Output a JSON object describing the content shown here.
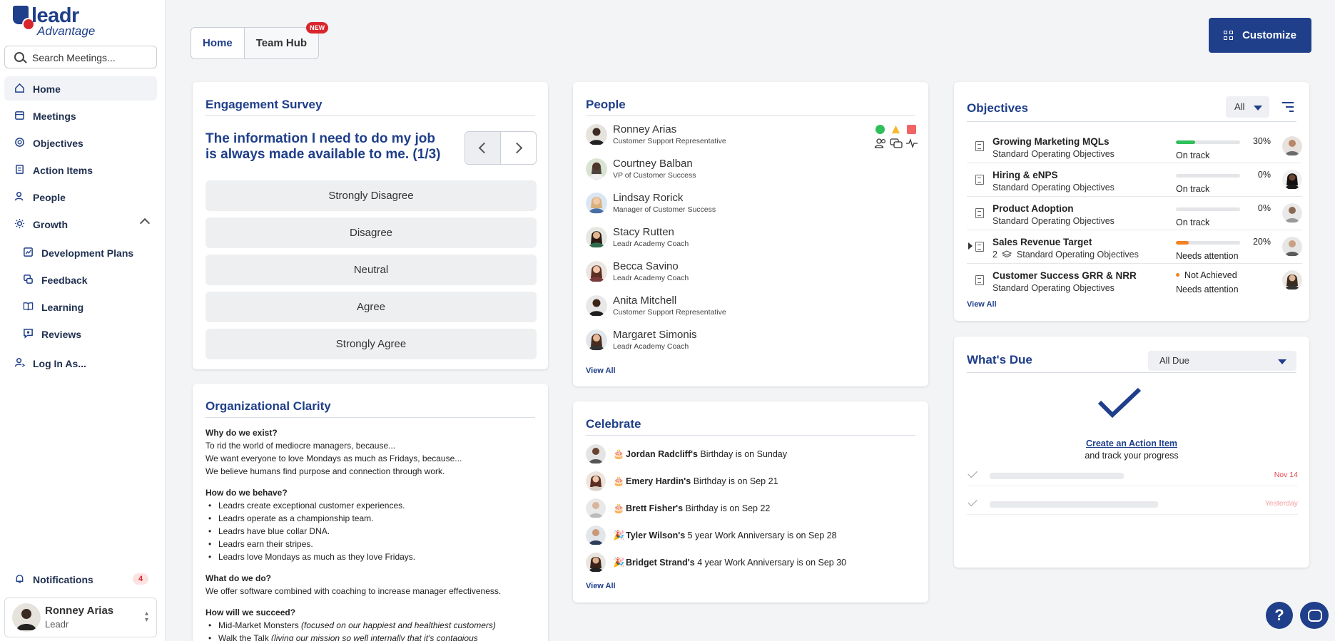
{
  "brand": {
    "name": "leadr",
    "sub": "Advantage"
  },
  "search": {
    "placeholder": "Search Meetings..."
  },
  "sidebar": {
    "items": [
      {
        "label": "Home",
        "icon": "home-icon",
        "active": true
      },
      {
        "label": "Meetings",
        "icon": "calendar-icon"
      },
      {
        "label": "Objectives",
        "icon": "target-icon"
      },
      {
        "label": "Action Items",
        "icon": "checklist-icon"
      },
      {
        "label": "People",
        "icon": "people-icon"
      },
      {
        "label": "Growth",
        "icon": "sun-icon"
      }
    ],
    "growth_items": [
      {
        "label": "Development Plans",
        "icon": "chart-icon"
      },
      {
        "label": "Feedback",
        "icon": "feedback-icon"
      },
      {
        "label": "Learning",
        "icon": "book-icon"
      },
      {
        "label": "Reviews",
        "icon": "review-icon"
      }
    ],
    "login_as": "Log In As...",
    "notifications": {
      "label": "Notifications",
      "count": "4"
    },
    "user": {
      "name": "Ronney Arias",
      "role": "Leadr"
    }
  },
  "tabs": [
    {
      "label": "Home",
      "active": true
    },
    {
      "label": "Team Hub",
      "badge": "NEW"
    }
  ],
  "customize_label": "Customize",
  "engagement": {
    "title": "Engagement Survey",
    "question": "The information I need to do my job is always made available to me.  (1/3)",
    "options": [
      "Strongly Disagree",
      "Disagree",
      "Neutral",
      "Agree",
      "Strongly Agree"
    ]
  },
  "org": {
    "title": "Organizational Clarity",
    "sections": [
      {
        "heading": "Why do we exist?",
        "lines": [
          "To rid the world of mediocre managers, because...",
          "We want everyone to love Mondays as much as Fridays, because...",
          "We believe humans find purpose and connection through work."
        ]
      },
      {
        "heading": "How do we behave?",
        "bullets": [
          "Leadrs create exceptional customer experiences.",
          "Leadrs operate as a championship team.",
          "Leadrs have blue collar DNA.",
          "Leadrs earn their stripes.",
          "Leadrs love Mondays as much as they love Fridays."
        ]
      },
      {
        "heading": "What do we do?",
        "lines": [
          "We offer software combined with coaching to increase manager effectiveness."
        ]
      },
      {
        "heading": "How will we succeed?",
        "bullets_rich": [
          {
            "main": "Mid-Market Monsters ",
            "em": "(focused on our happiest and healthiest customers)"
          },
          {
            "main": "Walk the Talk ",
            "em": "(living our mission so well internally that it's contagious"
          }
        ]
      }
    ]
  },
  "people": {
    "title": "People",
    "list": [
      {
        "name": "Ronney Arias",
        "title": "Customer Support Representative"
      },
      {
        "name": "Courtney Balban",
        "title": "VP of Customer Success"
      },
      {
        "name": "Lindsay Rorick",
        "title": "Manager of Customer Success"
      },
      {
        "name": "Stacy Rutten",
        "title": "Leadr Academy Coach"
      },
      {
        "name": "Becca Savino",
        "title": "Leadr Academy Coach"
      },
      {
        "name": "Anita Mitchell",
        "title": "Customer Support Representative"
      },
      {
        "name": "Margaret Simonis",
        "title": "Leadr Academy Coach"
      }
    ],
    "view_all": "View All",
    "colors": {
      "green": "#2fbf5b",
      "amber": "#f5b82e",
      "red": "#f26464"
    }
  },
  "celebrate": {
    "title": "Celebrate",
    "list": [
      {
        "emoji": "🎂",
        "name": "Jordan Radcliff's",
        "text": " Birthday is on Sunday"
      },
      {
        "emoji": "🎂",
        "name": "Emery Hardin's",
        "text": " Birthday is on Sep 21"
      },
      {
        "emoji": "🎂",
        "name": "Brett Fisher's",
        "text": " Birthday is on Sep 22"
      },
      {
        "emoji": "🎉",
        "name": "Tyler Wilson's",
        "text": " 5 year Work Anniversary is on Sep 28"
      },
      {
        "emoji": "🎉",
        "name": "Bridget Strand's",
        "text": " 4 year Work Anniversary is on Sep 30"
      }
    ],
    "view_all": "View All"
  },
  "objectives": {
    "title": "Objectives",
    "filter": "All",
    "list": [
      {
        "name": "Growing Marketing MQLs",
        "sub": "Standard Operating Objectives",
        "progress": 30,
        "pct": "30%",
        "status": "On track",
        "color": "#2fbf5b"
      },
      {
        "name": "Hiring & eNPS",
        "sub": "Standard Operating Objectives",
        "progress": 0,
        "pct": "0%",
        "status": "On track",
        "color": "#2fbf5b"
      },
      {
        "name": "Product Adoption",
        "sub": "Standard Operating Objectives",
        "progress": 0,
        "pct": "0%",
        "status": "On track",
        "color": "#2fbf5b"
      },
      {
        "name": "Sales Revenue Target",
        "sub_count": "2",
        "sub": "Standard Operating Objectives",
        "progress": 20,
        "pct": "20%",
        "status": "Needs attention",
        "color": "#f5821f",
        "expandable": true
      },
      {
        "name": "Customer Success GRR & NRR",
        "sub": "Standard Operating Objectives",
        "badge": "Not Achieved",
        "status": "Needs attention"
      }
    ],
    "view_all": "View All"
  },
  "due": {
    "title": "What's Due",
    "filter": "All Due",
    "create_link": "Create an Action Item",
    "create_sub": "and track your progress",
    "rows": [
      {
        "date": "Nov 14",
        "color": "#e2484d"
      },
      {
        "date": "Yesterday",
        "color": "#f2a0a2"
      }
    ]
  }
}
